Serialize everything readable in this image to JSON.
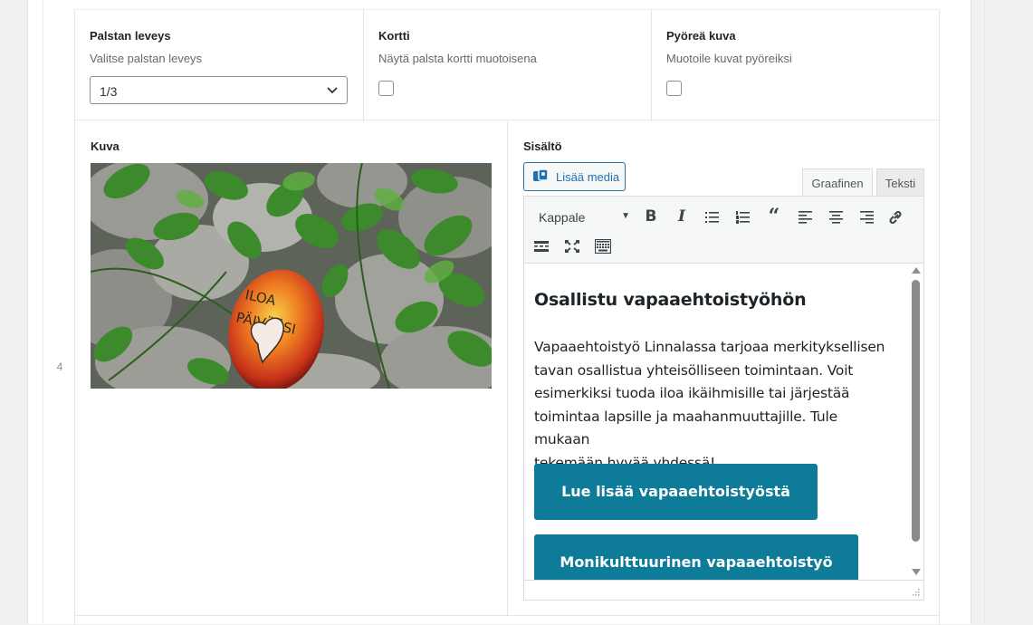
{
  "row_number": "4",
  "settings": {
    "column_width": {
      "label": "Palstan leveys",
      "description": "Valitse palstan leveys",
      "value": "1/3"
    },
    "card": {
      "label": "Kortti",
      "description": "Näytä palsta kortti muotoisena",
      "checked": false
    },
    "round_image": {
      "label": "Pyöreä kuva",
      "description": "Muotoile kuvat pyöreiksi",
      "checked": false
    }
  },
  "image_field": {
    "label": "Kuva",
    "stone_text": "ILOA PÄIVÄÄSI"
  },
  "content_field": {
    "label": "Sisältö",
    "add_media_label": "Lisää media",
    "tabs": [
      {
        "label": "Graafinen",
        "active": true
      },
      {
        "label": "Teksti",
        "active": false
      }
    ],
    "format_select": "Kappale",
    "toolbar_icons": [
      "bold-icon",
      "italic-icon",
      "bullet-list-icon",
      "numbered-list-icon",
      "blockquote-icon",
      "align-left-icon",
      "align-center-icon",
      "align-right-icon",
      "link-icon",
      "read-more-icon",
      "fullscreen-icon",
      "toolbar-toggle-icon"
    ],
    "editor": {
      "heading": "Osallistu vapaaehtoistyöhön",
      "paragraph_lines": [
        "Vapaaehtoistyö Linnalassa tarjoaa merkityksellisen",
        "tavan osallistua yhteisölliseen toimintaan. Voit",
        "esimerkiksi tuoda iloa ikäihmisille tai järjestää",
        "toimintaa lapsille ja maahanmuuttajille. Tule mukaan",
        "tekemään hyvää yhdessä!"
      ],
      "buttons": [
        "Lue lisää vapaaehtoistyöstä",
        "Monikulttuurinen vapaaehtoistyö"
      ]
    }
  },
  "colors": {
    "accent": "#2271b1",
    "button_teal": "#0e7c99"
  }
}
